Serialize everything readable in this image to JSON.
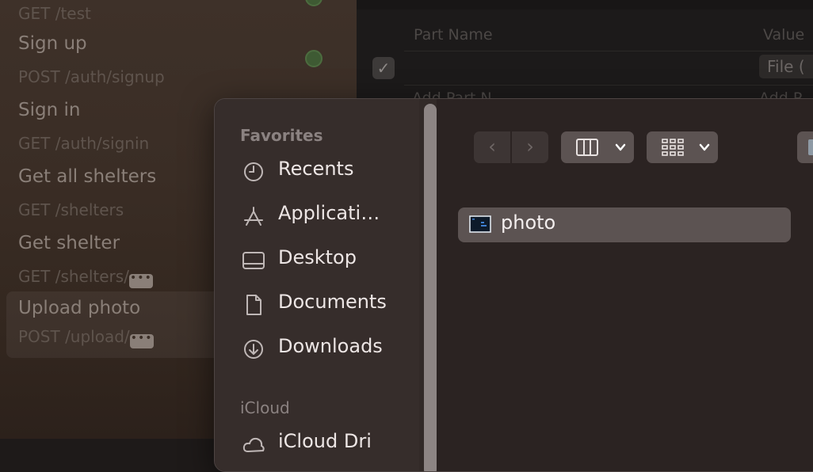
{
  "request_list": [
    {
      "name": "",
      "route": "GET /test"
    },
    {
      "name": "Sign up",
      "route": "POST /auth/signup"
    },
    {
      "name": "Sign in",
      "route": "GET /auth/signin"
    },
    {
      "name": "Get all shelters",
      "route": "GET /shelters"
    },
    {
      "name": "Get shelter",
      "route": "GET /shelters/",
      "has_more": true
    },
    {
      "name": "Upload photo",
      "route": "POST /upload/",
      "has_more": true,
      "selected": true
    }
  ],
  "more_glyph": "•••",
  "body_table": {
    "col_part_name": "Part Name",
    "col_value": "Value",
    "row1_value": "File (",
    "add_part_name": "Add Part N",
    "add_part_value": "Add P"
  },
  "file_dialog": {
    "sidebar": {
      "favorites_label": "Favorites",
      "favorites": [
        {
          "label": "Recents",
          "icon": "clock-icon"
        },
        {
          "label": "Applicati…",
          "icon": "applications-icon"
        },
        {
          "label": "Desktop",
          "icon": "desktop-icon"
        },
        {
          "label": "Documents",
          "icon": "document-icon"
        },
        {
          "label": "Downloads",
          "icon": "downloads-icon"
        }
      ],
      "icloud_label": "iCloud",
      "icloud_items": [
        {
          "label": "iCloud Dri",
          "icon": "icloud-icon"
        }
      ]
    },
    "toolbar": {
      "back": "‹",
      "forward": "›"
    },
    "files": [
      {
        "label": "photo",
        "icon": "image-file-icon",
        "selected": true
      }
    ]
  },
  "colors": {
    "accent_status_green": "#3e5a33",
    "selection_bg": "#5c5352"
  }
}
